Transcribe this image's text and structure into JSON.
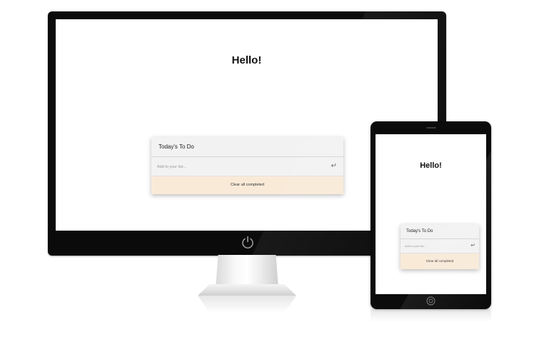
{
  "desktop": {
    "heading": "Hello!",
    "todo": {
      "title": "Today's To Do",
      "input_placeholder": "Add to your list...",
      "enter_icon": "enter-return-icon",
      "clear_label": "Clear all completed"
    }
  },
  "tablet": {
    "heading": "Hello!",
    "todo": {
      "title": "Today's To Do",
      "input_placeholder": "Add to your list...",
      "enter_icon": "enter-return-icon",
      "clear_label": "Clear all completed"
    }
  },
  "colors": {
    "device_frame": "#0b0b0b",
    "screen_bg": "#ffffff",
    "header_bg": "#f2f2f2",
    "clear_button_bg": "#f9ead8"
  }
}
